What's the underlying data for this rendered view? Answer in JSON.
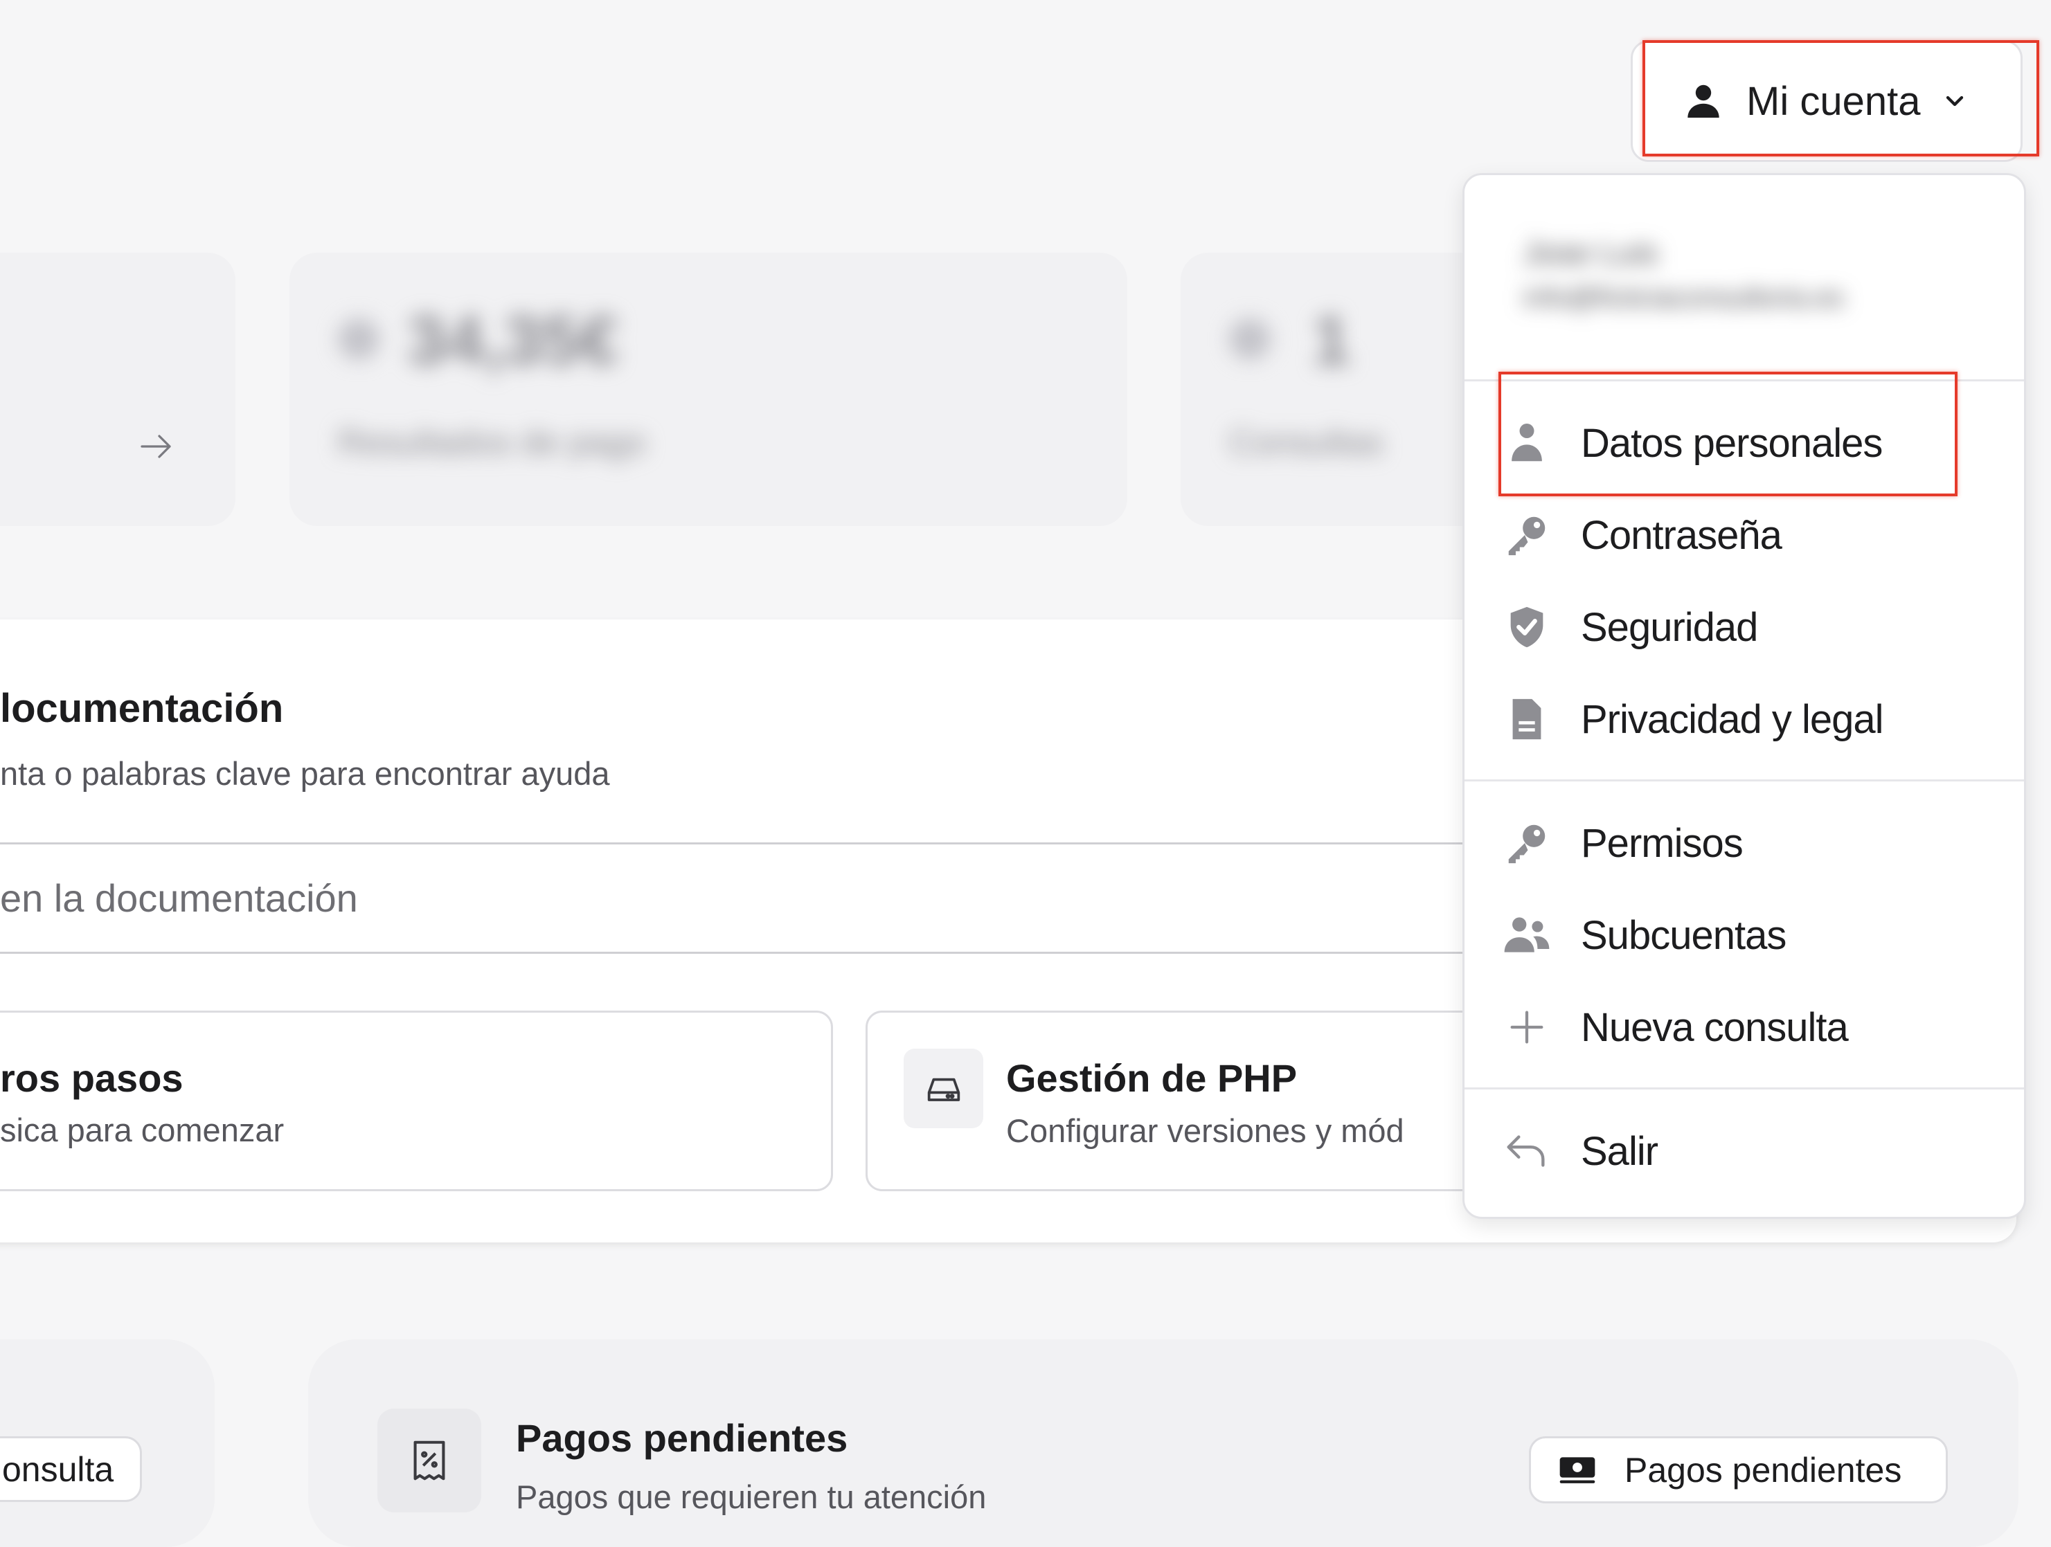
{
  "account": {
    "button_label": "Mi cuenta",
    "user_name": "Jose Luis",
    "user_email": "info@ficticiaconsultoria.es"
  },
  "menu": {
    "section1": [
      "Datos personales",
      "Contraseña",
      "Seguridad",
      "Privacidad y legal"
    ],
    "section2": [
      "Permisos",
      "Subcuentas",
      "Nueva consulta"
    ],
    "logout": "Salir"
  },
  "stats": {
    "card2_value": "34,35€",
    "card2_label": "Resultados de pago",
    "card3_value": "1",
    "card3_label": "Consultas"
  },
  "docs": {
    "title": "locumentación",
    "subtitle": "nta o palabras clave para encontrar ayuda",
    "search_placeholder": "en la documentación"
  },
  "cards": {
    "first_title": "ros pasos",
    "first_sub": "sica para comenzar",
    "php_title": "Gestión de PHP",
    "php_sub": "Configurar versiones y mód"
  },
  "bottom": {
    "consulta_button": "onsulta",
    "pagos_title": "Pagos pendientes",
    "pagos_sub": "Pagos que requieren tu atención",
    "pagos_button": "Pagos pendientes"
  },
  "colors": {
    "highlight": "#e53a2a",
    "icon_gray": "#8e8e93"
  }
}
